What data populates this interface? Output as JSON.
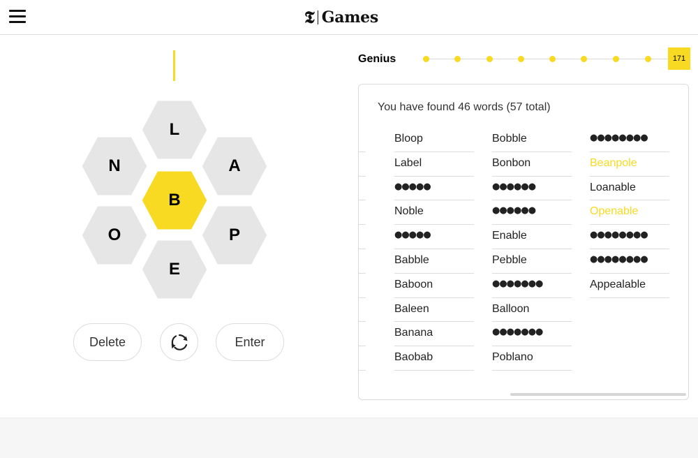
{
  "header": {
    "menu_icon": "hamburger-icon",
    "logo_mark": "𝕿",
    "logo_text": "Games"
  },
  "hive": {
    "center_letter": "B",
    "outer_letters": {
      "top": "L",
      "upper_left": "N",
      "upper_right": "A",
      "lower_left": "O",
      "lower_right": "P",
      "bottom": "E"
    },
    "center_color": "#f7da21",
    "outer_color": "#e6e6e6"
  },
  "controls": {
    "delete_label": "Delete",
    "shuffle_icon": "shuffle-icon",
    "enter_label": "Enter"
  },
  "progress": {
    "rank": "Genius",
    "score": "171",
    "accent_color": "#f7da21"
  },
  "word_list": {
    "summary": "You have found 46 words (57 total)",
    "columns": [
      [
        {
          "text": "Bloop",
          "type": "found"
        },
        {
          "text": "Label",
          "type": "found"
        },
        {
          "text": "●●●●●",
          "type": "hidden"
        },
        {
          "text": "Noble",
          "type": "found"
        },
        {
          "text": "●●●●●",
          "type": "hidden"
        },
        {
          "text": "Babble",
          "type": "found"
        },
        {
          "text": "Baboon",
          "type": "found"
        },
        {
          "text": "Baleen",
          "type": "found"
        },
        {
          "text": "Banana",
          "type": "found"
        },
        {
          "text": "Baobab",
          "type": "found"
        }
      ],
      [
        {
          "text": "Bobble",
          "type": "found"
        },
        {
          "text": "Bonbon",
          "type": "found"
        },
        {
          "text": "●●●●●●",
          "type": "hidden"
        },
        {
          "text": "●●●●●●",
          "type": "hidden"
        },
        {
          "text": "Enable",
          "type": "found"
        },
        {
          "text": "Pebble",
          "type": "found"
        },
        {
          "text": "●●●●●●●",
          "type": "hidden"
        },
        {
          "text": "Balloon",
          "type": "found"
        },
        {
          "text": "●●●●●●●",
          "type": "hidden"
        },
        {
          "text": "Poblano",
          "type": "found"
        }
      ],
      [
        {
          "text": "●●●●●●●●",
          "type": "hidden"
        },
        {
          "text": "Beanpole",
          "type": "pangram"
        },
        {
          "text": "Loanable",
          "type": "found"
        },
        {
          "text": "Openable",
          "type": "pangram"
        },
        {
          "text": "●●●●●●●●",
          "type": "hidden"
        },
        {
          "text": "●●●●●●●●",
          "type": "hidden"
        },
        {
          "text": "Appealable",
          "type": "found"
        }
      ]
    ]
  }
}
